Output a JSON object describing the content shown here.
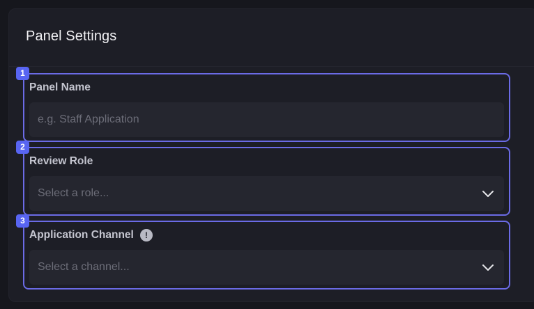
{
  "panel": {
    "title": "Panel Settings"
  },
  "fields": [
    {
      "number": "1",
      "label": "Panel Name",
      "type": "text",
      "placeholder": "e.g. Staff Application",
      "value": ""
    },
    {
      "number": "2",
      "label": "Review Role",
      "type": "select",
      "placeholder": "Select a role..."
    },
    {
      "number": "3",
      "label": "Application Channel",
      "type": "select",
      "placeholder": "Select a channel...",
      "info_icon": "!"
    }
  ],
  "colors": {
    "accent": "#5865f2",
    "field_border": "#6b6be6",
    "background": "#16171d",
    "panel_background": "#1d1e26",
    "input_background": "#25262f"
  }
}
